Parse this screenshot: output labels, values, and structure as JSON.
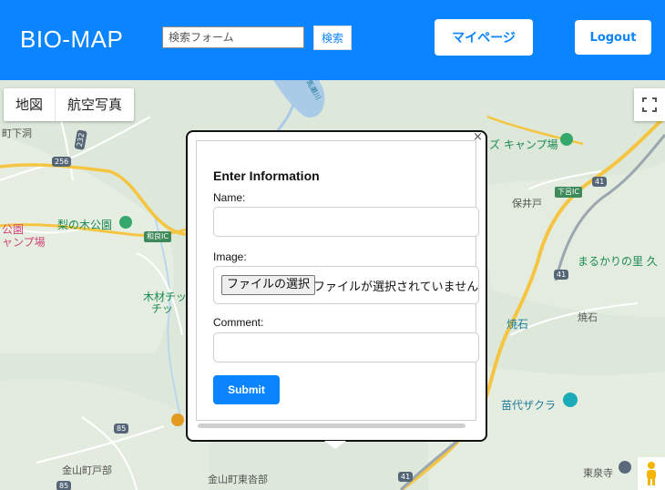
{
  "header": {
    "brand": "BIO-MAP",
    "search_placeholder": "検索フォーム",
    "search_button": "検索",
    "mypage_button": "マイページ",
    "logout_button": "Logout"
  },
  "map": {
    "type_tabs": [
      "地図",
      "航空写真"
    ],
    "labels": {
      "machi_shimohora": "町下洞",
      "park_left_1": "公園",
      "park_left_2": "ャンプ場",
      "nashinoki": "梨の木公園",
      "camp": "ズ キャンプ場",
      "hoido": "保井戸",
      "wara_ic": "和良IC",
      "shimoro_ic": "下呂IC",
      "mokuzai_1": "木材チッ",
      "mokuzai_2": "チッ",
      "marukari": "まるかりの里 久",
      "yakeishi_1": "焼石",
      "yakeishi_2": "焼石",
      "naeshiro": "苗代ザクラ",
      "kanayama_tobe": "金山町戸部",
      "kanayama_higashi": "金山町東沓部",
      "tosenji": "東泉寺",
      "dam_lake": "馬瀬川"
    },
    "road_numbers": {
      "r256": "256",
      "r41_a": "41",
      "r41_b": "41",
      "r41_c": "41",
      "r85": "85",
      "r85_b": "85",
      "r232": "232"
    }
  },
  "form": {
    "title": "Enter Information",
    "name_label": "Name:",
    "image_label": "Image:",
    "file_button": "ファイルの選択",
    "file_status": "ファイルが選択されていません",
    "comment_label": "Comment:",
    "submit_button": "Submit",
    "close_glyph": "×"
  }
}
